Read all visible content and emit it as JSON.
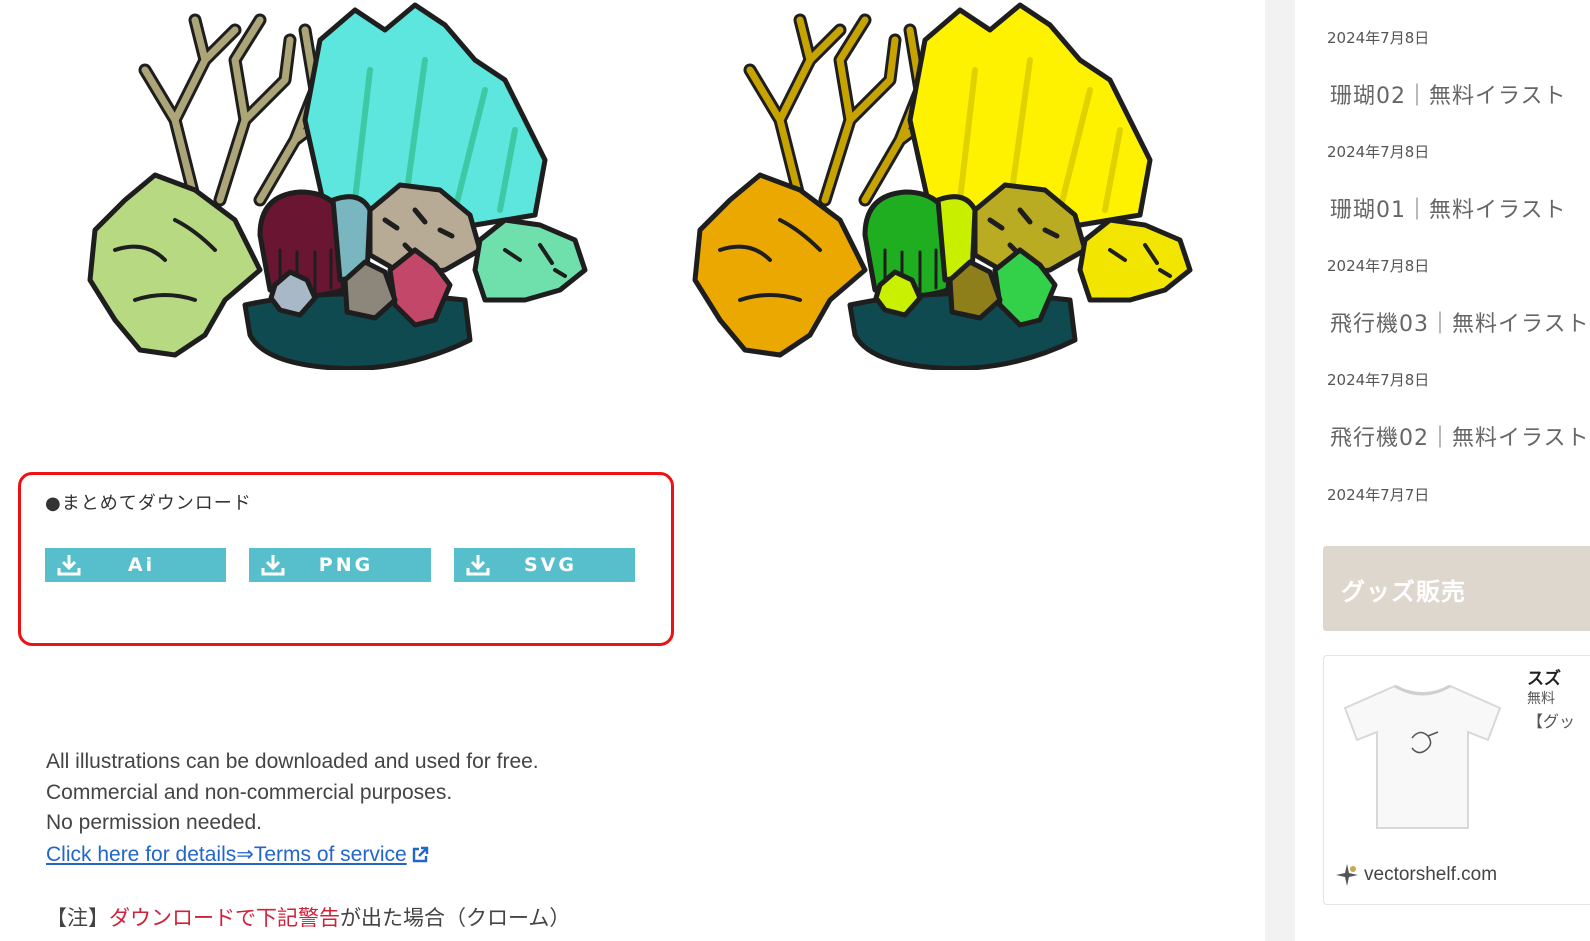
{
  "download": {
    "heading": "●まとめてダウンロード",
    "buttons": [
      {
        "label": "Ai"
      },
      {
        "label": "PNG"
      },
      {
        "label": "SVG"
      }
    ],
    "accent": "#56bfcb",
    "highlight_border": "#ee1111"
  },
  "license": {
    "line1": "All illustrations can be downloaded and used for free.",
    "line2": "Commercial and non-commercial purposes.",
    "line3": "No permission needed.",
    "link": "Click here for details⇒Terms of service"
  },
  "note": {
    "prefix": "【注】",
    "highlight": "ダウンロードで下記警告",
    "suffix": "が出た場合（クローム）"
  },
  "sidebar": {
    "posts": [
      {
        "date": "2024年7月8日",
        "title": "珊瑚02｜無料イラスト"
      },
      {
        "date": "2024年7月8日",
        "title": "珊瑚01｜無料イラスト"
      },
      {
        "date": "2024年7月8日",
        "title": "飛行機03｜無料イラスト"
      },
      {
        "date": "2024年7月8日",
        "title": "飛行機02｜無料イラスト"
      },
      {
        "date": "2024年7月7日",
        "title": ""
      }
    ],
    "goods_heading": "グッズ販売",
    "card": {
      "title": "スズ",
      "sub1": "無料",
      "sub2": "【グッ",
      "site": "vectorshelf.com"
    }
  },
  "icons": {
    "download": "download-icon",
    "external": "external-link-icon"
  }
}
